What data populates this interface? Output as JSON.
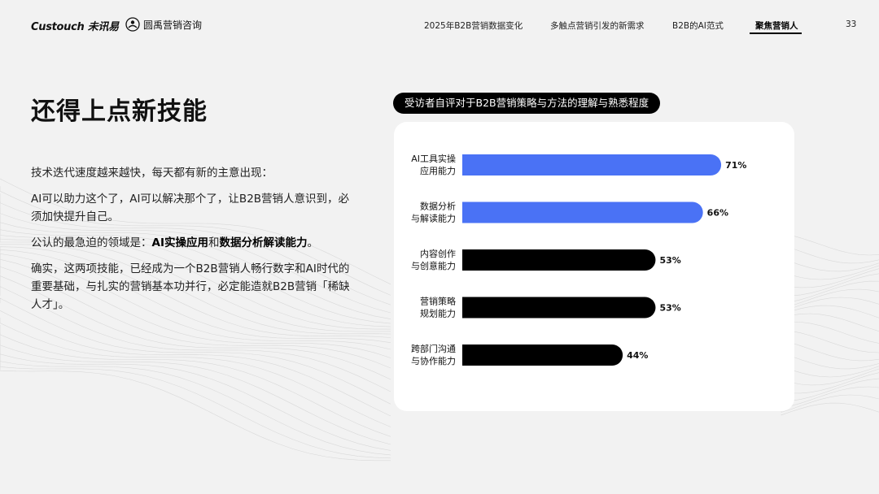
{
  "header": {
    "logo_custouch": "Custouch 未讯易",
    "logo_partner": "圆禹营销咨询",
    "nav": [
      "2025年B2B营销数据变化",
      "多触点营销引发的新需求",
      "B2B的AI范式",
      "聚焦营销人"
    ],
    "active_nav_index": 3,
    "page_number": "33"
  },
  "main": {
    "title": "还得上点新技能",
    "para1": "技术迭代速度越来越快，每天都有新的主意出现：",
    "para2": "AI可以助力这个了，AI可以解决那个了，让B2B营销人意识到，必须加快提升自己。",
    "para3_prefix": "公认的最急迫的领域是：",
    "para3_bold1": "AI实操应用",
    "para3_mid": "和",
    "para3_bold2": "数据分析解读能力",
    "para3_suffix": "。",
    "para4": "确实，这两项技能，已经成为一个B2B营销人畅行数字和AI时代的重要基础，与扎实的营销基本功并行，必定能造就B2B营销「稀缺人才」。"
  },
  "chart_data": {
    "type": "bar",
    "orientation": "horizontal",
    "title": "受访者自评对于B2B营销策略与方法的理解与熟悉程度",
    "categories": [
      [
        "AI工具实操",
        "应用能力"
      ],
      [
        "数据分析",
        "与解读能力"
      ],
      [
        "内容创作",
        "与创意能力"
      ],
      [
        "营销策略",
        "规划能力"
      ],
      [
        "跨部门沟通",
        "与协作能力"
      ]
    ],
    "values": [
      71,
      66,
      53,
      53,
      44
    ],
    "value_labels": [
      "71%",
      "66%",
      "53%",
      "53%",
      "44%"
    ],
    "unit": "%",
    "xlim": [
      0,
      100
    ],
    "colors": [
      "#4a72f5",
      "#4a72f5",
      "#000000",
      "#000000",
      "#000000"
    ],
    "grid": false
  }
}
